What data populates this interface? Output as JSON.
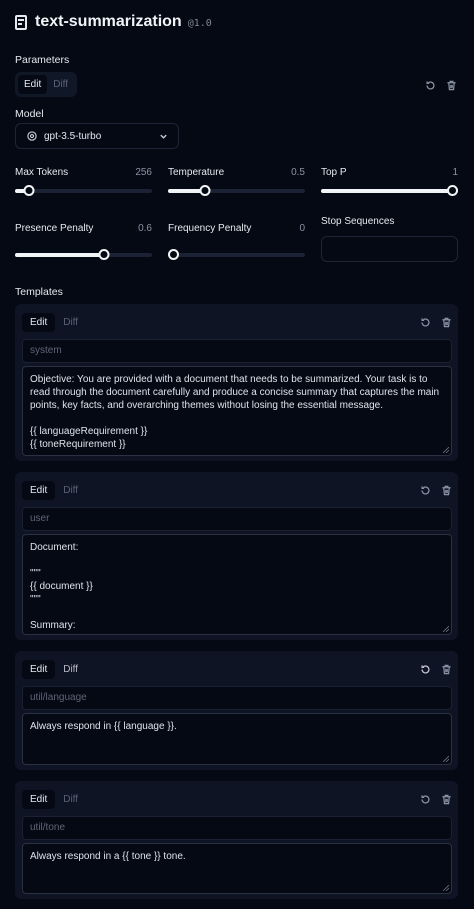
{
  "header": {
    "title": "text-summarization",
    "version": "@1.0"
  },
  "parameters": {
    "label": "Parameters",
    "tabs": {
      "edit": "Edit",
      "diff": "Diff"
    },
    "model_label": "Model",
    "model_value": "gpt-3.5-turbo",
    "max_tokens": {
      "name": "Max Tokens",
      "value": "256",
      "fraction": 0.1
    },
    "temperature": {
      "name": "Temperature",
      "value": "0.5",
      "fraction": 0.27
    },
    "top_p": {
      "name": "Top P",
      "value": "1",
      "fraction": 1.0
    },
    "presence_penalty": {
      "name": "Presence Penalty",
      "value": "0.6",
      "fraction": 0.65
    },
    "frequency_penalty": {
      "name": "Frequency Penalty",
      "value": "0",
      "fraction": 0.0
    },
    "stop_sequences": {
      "name": "Stop Sequences",
      "value": ""
    }
  },
  "templates": {
    "label": "Templates",
    "items": [
      {
        "tabs": {
          "edit": "Edit",
          "diff": "Diff"
        },
        "role": "system",
        "content": "Objective: You are provided with a document that needs to be summarized. Your task is to read through the document carefully and produce a concise summary that captures the main points, key facts, and overarching themes without losing the essential message.\n\n{{ languageRequirement }}\n{{ toneRequirement }}"
      },
      {
        "tabs": {
          "edit": "Edit",
          "diff": "Diff"
        },
        "role": "user",
        "content": "Document:\n\n\"\"\"\n{{ document }}\n\"\"\"\n\nSummary:"
      },
      {
        "tabs": {
          "edit": "Edit",
          "diff": "Diff"
        },
        "role": "util/language",
        "content": "Always respond in {{ language }}."
      },
      {
        "tabs": {
          "edit": "Edit",
          "diff": "Diff"
        },
        "role": "util/tone",
        "content": "Always respond in a {{ tone }} tone."
      }
    ]
  },
  "colors": {
    "background": "#050914",
    "panel": "#0e1424",
    "accent": "#f3f4f6"
  }
}
